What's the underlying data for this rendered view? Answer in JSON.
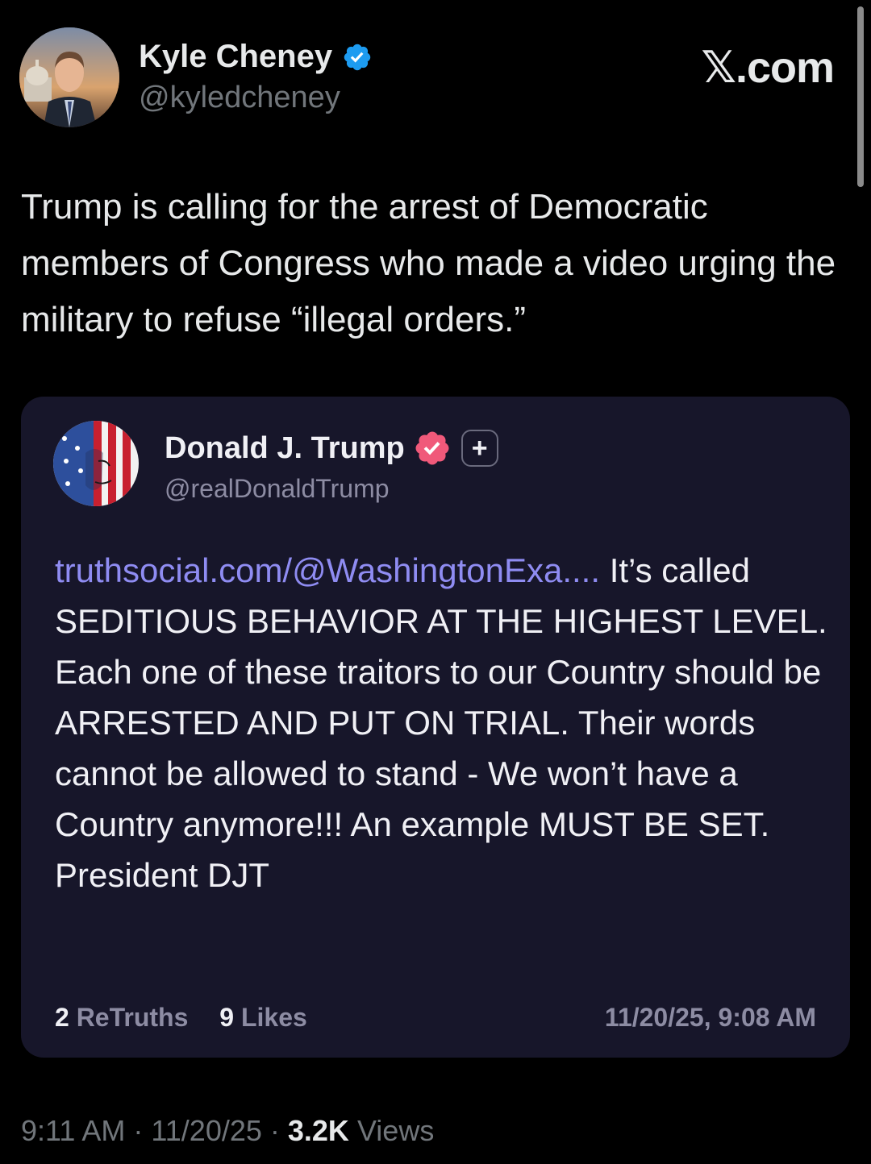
{
  "colors": {
    "background": "#000000",
    "card_background": "#17162a",
    "link": "#8f8cf2",
    "verified_blue": "#1d9bf0",
    "truth_badge_pink": "#f0597a"
  },
  "header": {
    "author_name": "Kyle Cheney",
    "author_handle": "@kyledcheney",
    "verified_icon": "verified-badge-icon",
    "brand": "𝕏.com"
  },
  "tweet": {
    "text": "Trump is calling for the arrest of Democratic members of Congress who made a video urging the military to refuse “illegal orders.”"
  },
  "quoted_post": {
    "author_name": "Donald J. Trump",
    "author_handle": "@realDonaldTrump",
    "badge_icon": "truth-verified-badge-icon",
    "plus_badge": "+",
    "link_text": "truthsocial.com/@WashingtonExa....",
    "body_text": " It’s called SEDITIOUS BEHAVIOR AT THE HIGHEST LEVEL. Each one of these traitors to our Country should be ARRESTED AND PUT ON TRIAL. Their words cannot be allowed to stand - We won’t have a Country anymore!!! An example MUST BE SET. President DJT",
    "retruths_count": "2",
    "retruths_label": "ReTruths",
    "likes_count": "9",
    "likes_label": "Likes",
    "timestamp": "11/20/25, 9:08 AM"
  },
  "footer": {
    "time": "9:11 AM",
    "separator1": " · ",
    "date": "11/20/25",
    "separator2": " · ",
    "views_count": "3.2K",
    "views_label": " Views"
  }
}
